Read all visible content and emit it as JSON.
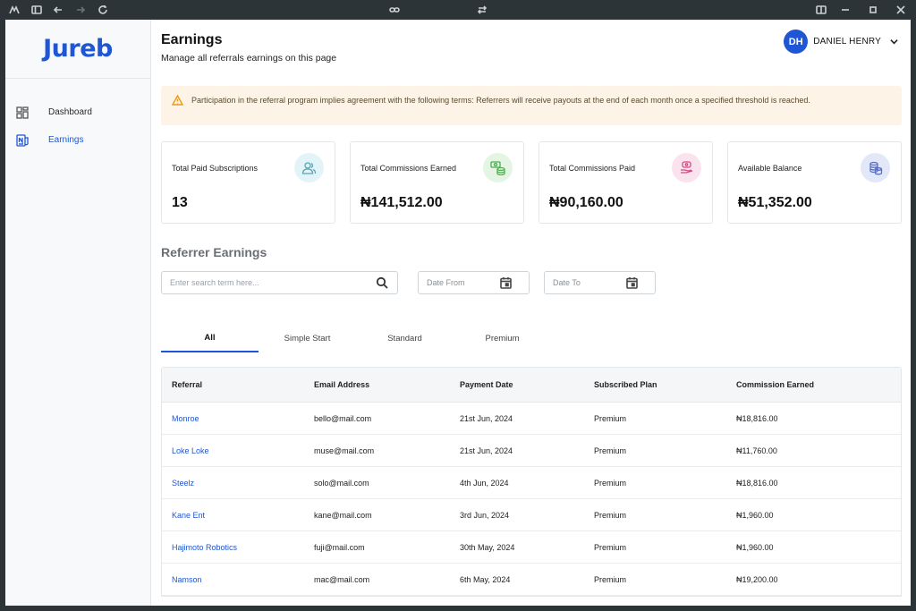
{
  "brand": {
    "name": "Jureb",
    "color": "#1e56d6"
  },
  "sidebar": {
    "items": [
      {
        "label": "Dashboard",
        "icon": "dashboard-grid-icon",
        "active": false
      },
      {
        "label": "Earnings",
        "icon": "earnings-icon",
        "active": true
      }
    ]
  },
  "header": {
    "title": "Earnings",
    "subtitle": "Manage all referrals earnings on this page",
    "user": {
      "initials": "DH",
      "name": "DANIEL HENRY"
    }
  },
  "notice": {
    "text": "Participation in the referral program implies agreement with the following terms: Referrers will receive payouts at the end of each month once a specified threshold is reached.",
    "icon": "warning-icon"
  },
  "cards": [
    {
      "label": "Total Paid Subscriptions",
      "value": "13",
      "icon": "users-icon",
      "bg": "#e3f4f8",
      "stroke": "#5aa4b8"
    },
    {
      "label": "Total Commissions Earned",
      "value": "₦141,512.00",
      "icon": "cash-stack-icon",
      "bg": "#e4f5e4",
      "stroke": "#4caf50"
    },
    {
      "label": "Total Commissions Paid",
      "value": "₦90,160.00",
      "icon": "hand-money-icon",
      "bg": "#fbe3ee",
      "stroke": "#d14b86"
    },
    {
      "label": "Available Balance",
      "value": "₦51,352.00",
      "icon": "coins-icon",
      "bg": "#e3e8f8",
      "stroke": "#5b6fc4"
    }
  ],
  "earnings": {
    "title": "Referrer Earnings",
    "search_placeholder": "Enter search term here...",
    "date_from_placeholder": "Date From",
    "date_to_placeholder": "Date To"
  },
  "tabs": [
    {
      "label": "All",
      "active": true
    },
    {
      "label": "Simple Start",
      "active": false
    },
    {
      "label": "Standard",
      "active": false
    },
    {
      "label": "Premium",
      "active": false
    }
  ],
  "table": {
    "columns": [
      "Referral",
      "Email Address",
      "Payment Date",
      "Subscribed Plan",
      "Commission Earned"
    ],
    "rows": [
      [
        "Monroe",
        "bello@mail.com",
        "21st Jun, 2024",
        "Premium",
        "₦18,816.00"
      ],
      [
        "Loke Loke",
        "muse@mail.com",
        "21st Jun, 2024",
        "Premium",
        "₦11,760.00"
      ],
      [
        "Steelz",
        "solo@mail.com",
        "4th Jun, 2024",
        "Premium",
        "₦18,816.00"
      ],
      [
        "Kane Ent",
        "kane@mail.com",
        "3rd Jun, 2024",
        "Premium",
        "₦1,960.00"
      ],
      [
        "Hajimoto Robotics",
        "fuji@mail.com",
        "30th May, 2024",
        "Premium",
        "₦1,960.00"
      ],
      [
        "Namson",
        "mac@mail.com",
        "6th May, 2024",
        "Premium",
        "₦19,200.00"
      ]
    ]
  }
}
